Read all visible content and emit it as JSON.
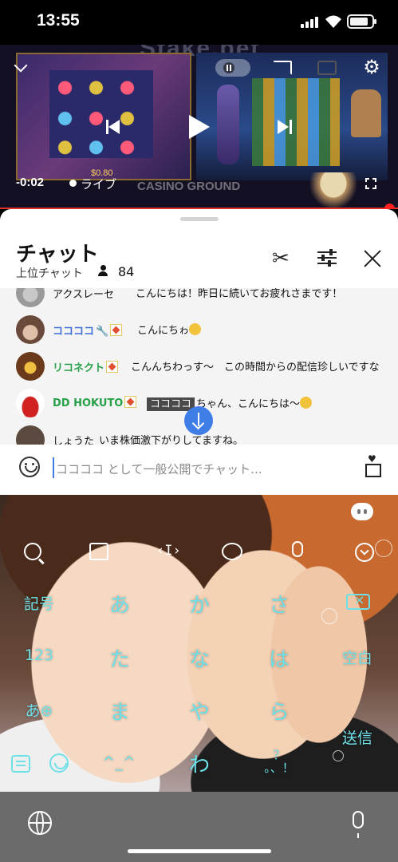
{
  "status_bar": {
    "time": "13:55"
  },
  "video": {
    "brand_text": "Stake.bet",
    "elapsed": "-0:02",
    "live_label": "ライブ",
    "slot_bet_text": "$0.80",
    "sponsor_text": "CASINO GROUND"
  },
  "chat": {
    "title": "チャット",
    "mode": "上位チャット",
    "viewer_count": "84",
    "messages": [
      {
        "author": "アクスレーセ",
        "text": "こんにちは！昨日に続いてお疲れさまです！",
        "name_color": "#111111"
      },
      {
        "author": "ココココ",
        "text": "こんにちゎ",
        "name_color": "#3f6fd6"
      },
      {
        "author": "リコネクト",
        "text": "こんんちわっす〜　この時間からの配信珍しいですな",
        "name_color": "#27a04a"
      },
      {
        "author": "DD HOKUTO",
        "mention": "ココココ",
        "text": "ちゃん、こんにちは〜",
        "name_color": "#27a04a"
      },
      {
        "author": "しょうた",
        "text": "いま株価激下がりしてますね。",
        "name_color": "#111111"
      }
    ],
    "input_placeholder": "ココココ として一般公開でチャット..."
  },
  "keyboard": {
    "rows": [
      [
        "記号",
        "あ",
        "か",
        "さ"
      ],
      [
        "123",
        "た",
        "な",
        "は",
        "空白"
      ],
      [
        "あ⊕",
        "ま",
        "や",
        "ら",
        "送信"
      ],
      [
        "^_^",
        "わ",
        "?!"
      ]
    ],
    "punct_label": "？\n。、！",
    "accent_color": "#6ee0e8"
  }
}
